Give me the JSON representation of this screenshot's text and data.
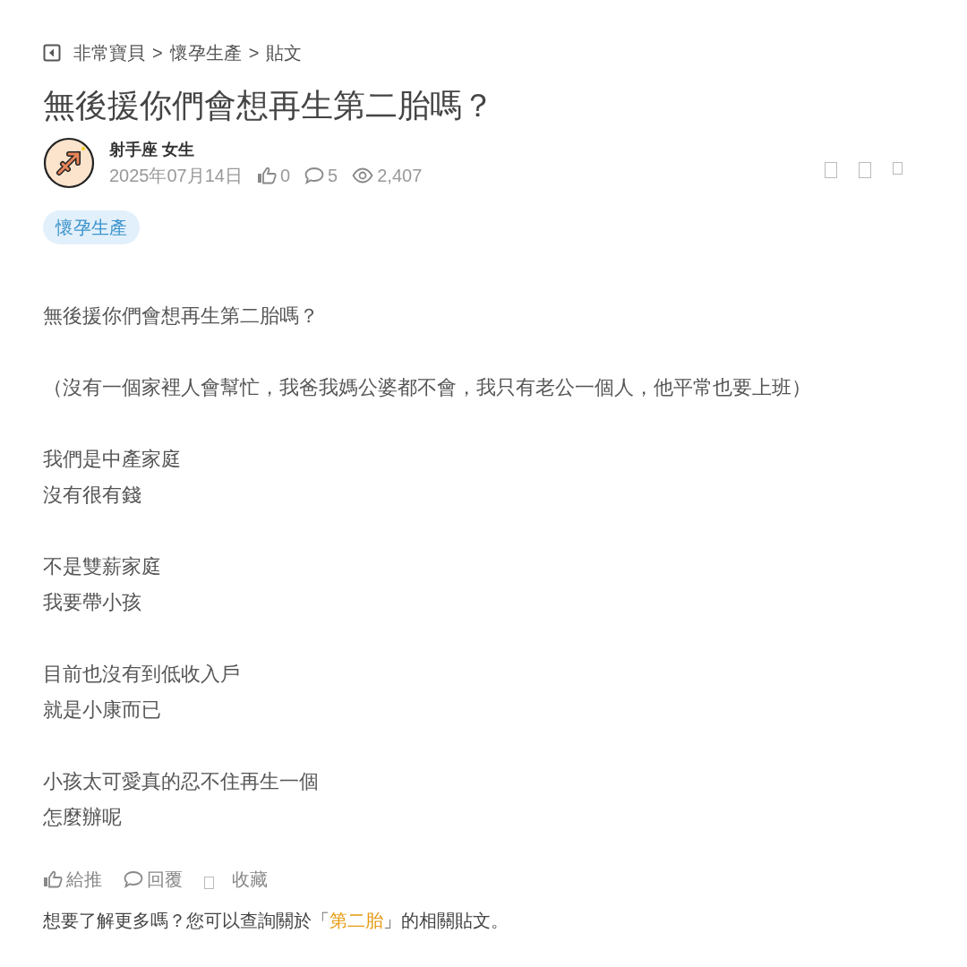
{
  "breadcrumb": [
    "非常寶貝",
    "懷孕生產",
    "貼文"
  ],
  "breadcrumb_separator": ">",
  "title": "無後援你們會想再生第二胎嗎？",
  "author": {
    "name": "射手座 女生",
    "date": "2025年07月14日",
    "likes": "0",
    "comments": "5",
    "views": "2,407"
  },
  "tag": "懷孕生產",
  "body": [
    [
      "無後援你們會想再生第二胎嗎？"
    ],
    [
      "（沒有一個家裡人會幫忙，我爸我媽公婆都不會，我只有老公一個人，他平常也要上班）"
    ],
    [
      "我們是中產家庭",
      "沒有很有錢"
    ],
    [
      "不是雙薪家庭",
      "我要帶小孩"
    ],
    [
      "目前也沒有到低收入戶",
      "就是小康而已"
    ],
    [
      "小孩太可愛真的忍不住再生一個",
      "怎麼辦呢"
    ]
  ],
  "actions": [
    {
      "kind": "like",
      "label": "給推"
    },
    {
      "kind": "reply",
      "label": "回覆"
    },
    {
      "kind": "save",
      "label": "收藏"
    }
  ],
  "related": {
    "before": "想要了解更多嗎？您可以查詢關於「",
    "link": "第二胎",
    "after": "」的相關貼文。"
  }
}
